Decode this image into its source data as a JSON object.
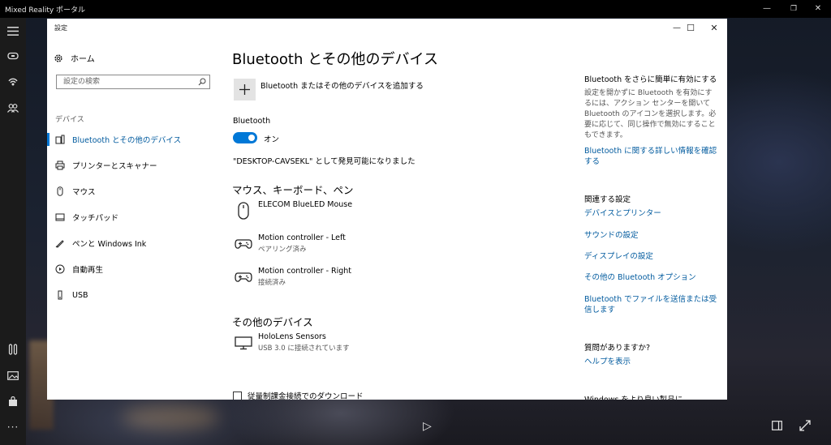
{
  "outer": {
    "title": "Mixed Reality ポータル",
    "controls": {
      "minimize": "—",
      "maximize": "❐",
      "close": "✕"
    },
    "rail_icons": [
      "menu-icon",
      "headset-icon",
      "broadcast-icon",
      "people-icon",
      "controller-icon",
      "image-icon",
      "store-icon",
      "more-icon"
    ],
    "more_label": "···",
    "bottom": {
      "play": "▷",
      "windowed": "▯",
      "expand": "⤢"
    }
  },
  "settings": {
    "window_title": "設定",
    "controls": {
      "minimize": "—",
      "maximize": "☐",
      "close": "✕"
    },
    "home_label": "ホーム",
    "search_placeholder": "設定の検索",
    "section_label": "デバイス",
    "nav": [
      {
        "label": "Bluetooth とその他のデバイス",
        "icon": "bluetooth-devices-icon",
        "active": true
      },
      {
        "label": "プリンターとスキャナー",
        "icon": "printer-icon",
        "active": false
      },
      {
        "label": "マウス",
        "icon": "mouse-icon",
        "active": false
      },
      {
        "label": "タッチパッド",
        "icon": "touchpad-icon",
        "active": false
      },
      {
        "label": "ペンと Windows Ink",
        "icon": "pen-icon",
        "active": false
      },
      {
        "label": "自動再生",
        "icon": "autoplay-icon",
        "active": false
      },
      {
        "label": "USB",
        "icon": "usb-icon",
        "active": false
      }
    ],
    "page_title": "Bluetooth とその他のデバイス",
    "add_device_label": "Bluetooth またはその他のデバイスを追加する",
    "bluetooth_label": "Bluetooth",
    "toggle_state": "オン",
    "discoverable_text": "\"DESKTOP-CAVSEKL\" として発見可能になりました",
    "mouse_section_title": "マウス、キーボード、ペン",
    "mouse_devices": [
      {
        "name": "ELECOM BlueLED Mouse",
        "status": "",
        "icon": "mouse-icon"
      },
      {
        "name": "Motion controller - Left",
        "status": "ペアリング済み",
        "icon": "gamepad-icon"
      },
      {
        "name": "Motion controller - Right",
        "status": "接続済み",
        "icon": "gamepad-icon"
      }
    ],
    "other_section_title": "その他のデバイス",
    "other_devices": [
      {
        "name": "HoloLens Sensors",
        "status": "USB 3.0 に接続されています",
        "icon": "monitor-icon"
      }
    ],
    "metered_download_label": "従量制課金接続でのダウンロード",
    "metered_download_checked": false,
    "side": {
      "tip_title": "Bluetooth をさらに簡単に有効にする",
      "tip_text": "設定を開かずに Bluetooth を有効にするには、アクション センターを開いて Bluetooth のアイコンを選択します。必要に応じて、同じ操作で無効にすることもできます。",
      "tip_link": "Bluetooth に関する詳しい情報を確認する",
      "related_title": "関連する設定",
      "related_links": [
        "デバイスとプリンター",
        "サウンドの設定",
        "ディスプレイの設定",
        "その他の Bluetooth オプション",
        "Bluetooth でファイルを送信または受信します"
      ],
      "question_title": "質問がありますか?",
      "help_link": "ヘルプを表示",
      "cutoff_title": "Windows をより良い製品に"
    },
    "accent_color": "#0078d7",
    "link_color": "#005a9e"
  }
}
